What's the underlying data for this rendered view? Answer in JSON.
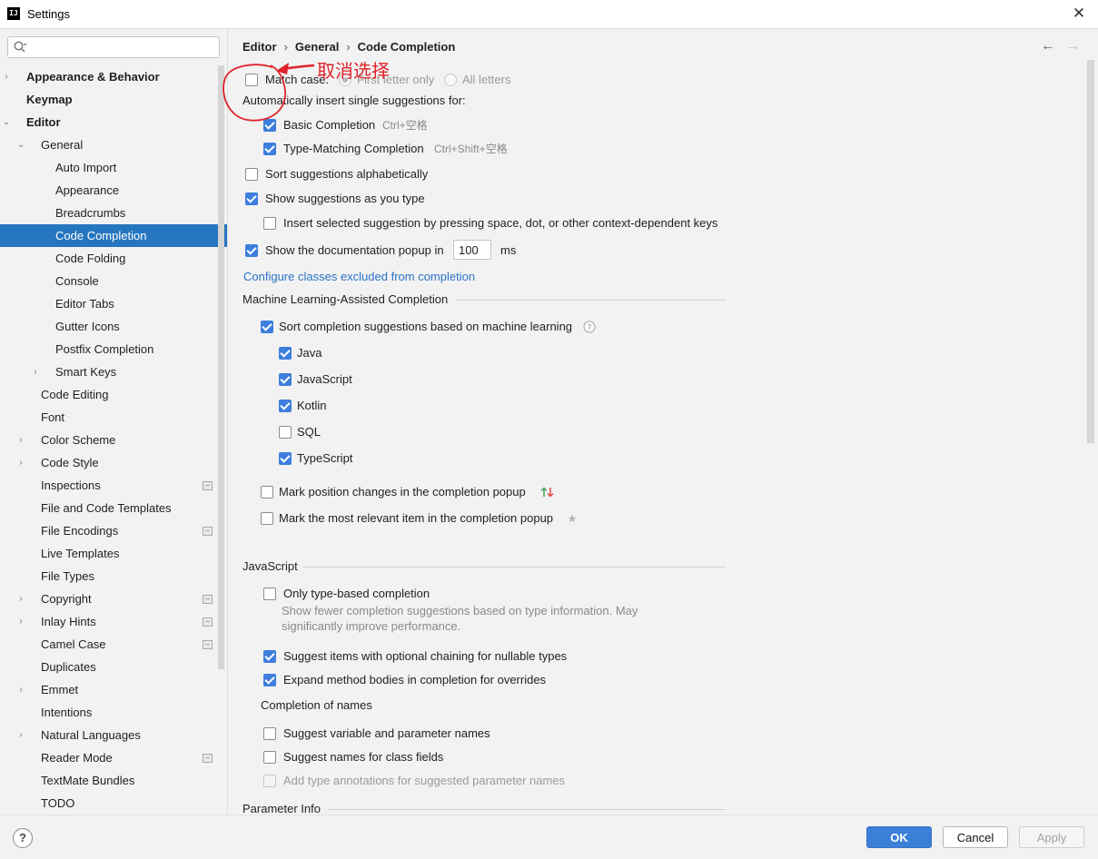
{
  "window": {
    "app_icon_text": "IJ",
    "title": "Settings",
    "close_glyph": "✕"
  },
  "sidebar": {
    "search": {
      "placeholder": "",
      "value": ""
    },
    "items": [
      {
        "label": "Appearance & Behavior",
        "level": 0,
        "bold": true,
        "arrow": "›",
        "badge": false
      },
      {
        "label": "Keymap",
        "level": 0,
        "bold": true,
        "arrow": "",
        "badge": false
      },
      {
        "label": "Editor",
        "level": 0,
        "bold": true,
        "arrow": "⌄",
        "badge": false
      },
      {
        "label": "General",
        "level": 1,
        "bold": false,
        "arrow": "⌄",
        "badge": false
      },
      {
        "label": "Auto Import",
        "level": 2,
        "bold": false,
        "arrow": "",
        "badge": false
      },
      {
        "label": "Appearance",
        "level": 2,
        "bold": false,
        "arrow": "",
        "badge": false
      },
      {
        "label": "Breadcrumbs",
        "level": 2,
        "bold": false,
        "arrow": "",
        "badge": false
      },
      {
        "label": "Code Completion",
        "level": 2,
        "bold": false,
        "arrow": "",
        "badge": false,
        "selected": true
      },
      {
        "label": "Code Folding",
        "level": 2,
        "bold": false,
        "arrow": "",
        "badge": false
      },
      {
        "label": "Console",
        "level": 2,
        "bold": false,
        "arrow": "",
        "badge": false
      },
      {
        "label": "Editor Tabs",
        "level": 2,
        "bold": false,
        "arrow": "",
        "badge": false
      },
      {
        "label": "Gutter Icons",
        "level": 2,
        "bold": false,
        "arrow": "",
        "badge": false
      },
      {
        "label": "Postfix Completion",
        "level": 2,
        "bold": false,
        "arrow": "",
        "badge": false
      },
      {
        "label": "Smart Keys",
        "level": 2,
        "bold": false,
        "arrow": "›",
        "badge": false
      },
      {
        "label": "Code Editing",
        "level": 1,
        "bold": false,
        "arrow": "",
        "badge": false
      },
      {
        "label": "Font",
        "level": 1,
        "bold": false,
        "arrow": "",
        "badge": false
      },
      {
        "label": "Color Scheme",
        "level": 1,
        "bold": false,
        "arrow": "›",
        "badge": false
      },
      {
        "label": "Code Style",
        "level": 1,
        "bold": false,
        "arrow": "›",
        "badge": false
      },
      {
        "label": "Inspections",
        "level": 1,
        "bold": false,
        "arrow": "",
        "badge": true
      },
      {
        "label": "File and Code Templates",
        "level": 1,
        "bold": false,
        "arrow": "",
        "badge": false
      },
      {
        "label": "File Encodings",
        "level": 1,
        "bold": false,
        "arrow": "",
        "badge": true
      },
      {
        "label": "Live Templates",
        "level": 1,
        "bold": false,
        "arrow": "",
        "badge": false
      },
      {
        "label": "File Types",
        "level": 1,
        "bold": false,
        "arrow": "",
        "badge": false
      },
      {
        "label": "Copyright",
        "level": 1,
        "bold": false,
        "arrow": "›",
        "badge": true
      },
      {
        "label": "Inlay Hints",
        "level": 1,
        "bold": false,
        "arrow": "›",
        "badge": true
      },
      {
        "label": "Camel Case",
        "level": 1,
        "bold": false,
        "arrow": "",
        "badge": true
      },
      {
        "label": "Duplicates",
        "level": 1,
        "bold": false,
        "arrow": "",
        "badge": false
      },
      {
        "label": "Emmet",
        "level": 1,
        "bold": false,
        "arrow": "›",
        "badge": false
      },
      {
        "label": "Intentions",
        "level": 1,
        "bold": false,
        "arrow": "",
        "badge": false
      },
      {
        "label": "Natural Languages",
        "level": 1,
        "bold": false,
        "arrow": "›",
        "badge": false
      },
      {
        "label": "Reader Mode",
        "level": 1,
        "bold": false,
        "arrow": "",
        "badge": true
      },
      {
        "label": "TextMate Bundles",
        "level": 1,
        "bold": false,
        "arrow": "",
        "badge": false
      },
      {
        "label": "TODO",
        "level": 1,
        "bold": false,
        "arrow": "",
        "badge": false
      }
    ]
  },
  "breadcrumb": {
    "part1": "Editor",
    "part2": "General",
    "part3": "Code Completion",
    "sep": "›"
  },
  "nav": {
    "back": "←",
    "forward": "→"
  },
  "annotation": {
    "text": "取消选择",
    "color": "#e0242a"
  },
  "match_case": {
    "label": "Match case:",
    "checked": false,
    "option_first": "First letter only",
    "option_all": "All letters"
  },
  "auto_insert": {
    "heading": "Automatically insert single suggestions for:",
    "basic": {
      "label": "Basic Completion",
      "shortcut": "Ctrl+空格",
      "checked": true
    },
    "type_matching": {
      "label": "Type-Matching Completion",
      "shortcut": "Ctrl+Shift+空格",
      "checked": true
    }
  },
  "sort_alpha": {
    "label": "Sort suggestions alphabetically",
    "checked": false
  },
  "show_as_type": {
    "label": "Show suggestions as you type",
    "checked": true
  },
  "insert_selected": {
    "label": "Insert selected suggestion by pressing space, dot, or other context-dependent keys",
    "checked": false
  },
  "doc_popup": {
    "label": "Show the documentation popup in",
    "value": "100",
    "unit": "ms",
    "checked": true
  },
  "configure_link": "Configure classes excluded from completion",
  "ml": {
    "section": "Machine Learning-Assisted Completion",
    "sort_ml": {
      "label": "Sort completion suggestions based on machine learning",
      "checked": true
    },
    "languages": [
      {
        "label": "Java",
        "checked": true
      },
      {
        "label": "JavaScript",
        "checked": true
      },
      {
        "label": "Kotlin",
        "checked": true
      },
      {
        "label": "SQL",
        "checked": false
      },
      {
        "label": "TypeScript",
        "checked": true
      }
    ],
    "mark_position": {
      "label": "Mark position changes in the completion popup",
      "checked": false
    },
    "mark_relevant": {
      "label": "Mark the most relevant item in the completion popup",
      "checked": false
    }
  },
  "javascript": {
    "section": "JavaScript",
    "type_based": {
      "label": "Only type-based completion",
      "checked": false,
      "desc1": "Show fewer completion suggestions based on type information. May",
      "desc2": "significantly improve performance."
    },
    "optional_chaining": {
      "label": "Suggest items with optional chaining for nullable types",
      "checked": true
    },
    "expand_bodies": {
      "label": "Expand method bodies in completion for overrides",
      "checked": true
    },
    "names_heading": "Completion of names",
    "var_names": {
      "label": "Suggest variable and parameter names",
      "checked": false
    },
    "class_fields": {
      "label": "Suggest names for class fields",
      "checked": false
    },
    "type_annotations": {
      "label": "Add type annotations for suggested parameter names",
      "checked": false,
      "disabled": true
    }
  },
  "param_info": {
    "section": "Parameter Info"
  },
  "footer": {
    "help": "?",
    "ok": "OK",
    "cancel": "Cancel",
    "apply": "Apply"
  },
  "colors": {
    "accent": "#2675bf",
    "checkbox": "#3d7ede",
    "link": "#2a72c6",
    "annotation": "#e0242a"
  }
}
